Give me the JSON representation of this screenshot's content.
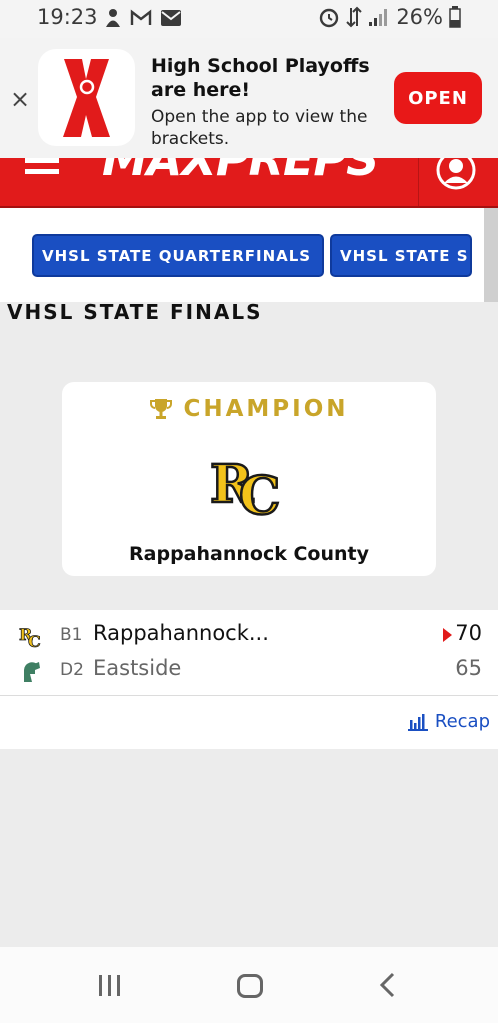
{
  "status_bar": {
    "time": "19:23",
    "battery_pct": "26%",
    "icons": [
      "app-notification-icon",
      "gmail-icon",
      "email-icon",
      "alarm-icon",
      "data-transfer-icon",
      "signal-icon",
      "battery-icon"
    ]
  },
  "app_banner": {
    "close_label": "×",
    "title": "High School Playoffs are here!",
    "subtitle": "Open the app to view the brackets.",
    "open_label": "OPEN",
    "logo_icon": "maxpreps-x-logo-icon"
  },
  "header": {
    "logo_text": "MAXPREPS",
    "menu_icon": "hamburger-icon",
    "user_icon": "user-icon",
    "brand_color": "#e11b1b"
  },
  "round_tabs": [
    {
      "label": "VHSL STATE QUARTERFINALS"
    },
    {
      "label": "VHSL STATE SEMIFINALS"
    }
  ],
  "section": {
    "title": "VHSL STATE FINALS"
  },
  "champion": {
    "label": "CHAMPION",
    "trophy_icon": "trophy-icon",
    "team_name": "Rappahannock County",
    "logo_text": "RC",
    "accent_color": "#c9a52a"
  },
  "game": {
    "teams": [
      {
        "seed": "B1",
        "name": "Rappahannock...",
        "score": "70",
        "winner": true,
        "logo_icon": "rc-logo-icon"
      },
      {
        "seed": "D2",
        "name": "Eastside",
        "score": "65",
        "winner": false,
        "logo_icon": "spartan-helmet-icon"
      }
    ],
    "recap_label": "Recap",
    "recap_icon": "bar-chart-icon",
    "link_color": "#1a4fc2"
  },
  "nav_bar": {
    "icons": [
      "recents-icon",
      "home-icon",
      "back-icon"
    ]
  }
}
